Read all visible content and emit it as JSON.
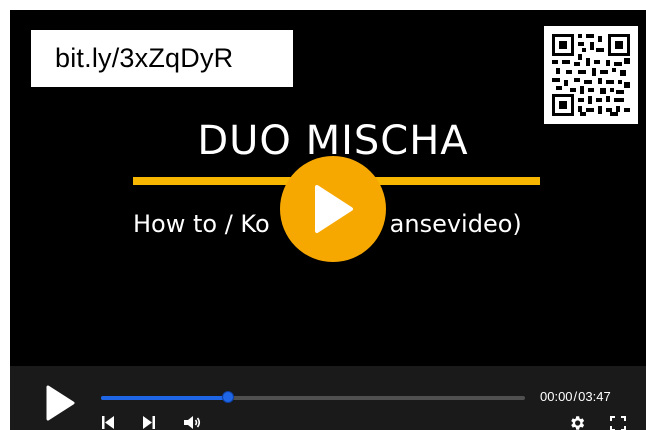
{
  "video": {
    "url_text": "bit.ly/3xZqDyR",
    "title": "DUO MISCHA",
    "subtitle": "How to / Ko",
    "subtitle_tail": "ansevideo)",
    "accent_color": "#f7b600"
  },
  "controls": {
    "current_time": "00:00",
    "separator": "/",
    "duration": "03:47",
    "progress_fraction": 0.3,
    "progress_color": "#1e66e6",
    "icons": [
      "play-icon",
      "skip-back-icon",
      "skip-forward-icon",
      "volume-icon",
      "gear-icon",
      "fullscreen-icon"
    ]
  }
}
